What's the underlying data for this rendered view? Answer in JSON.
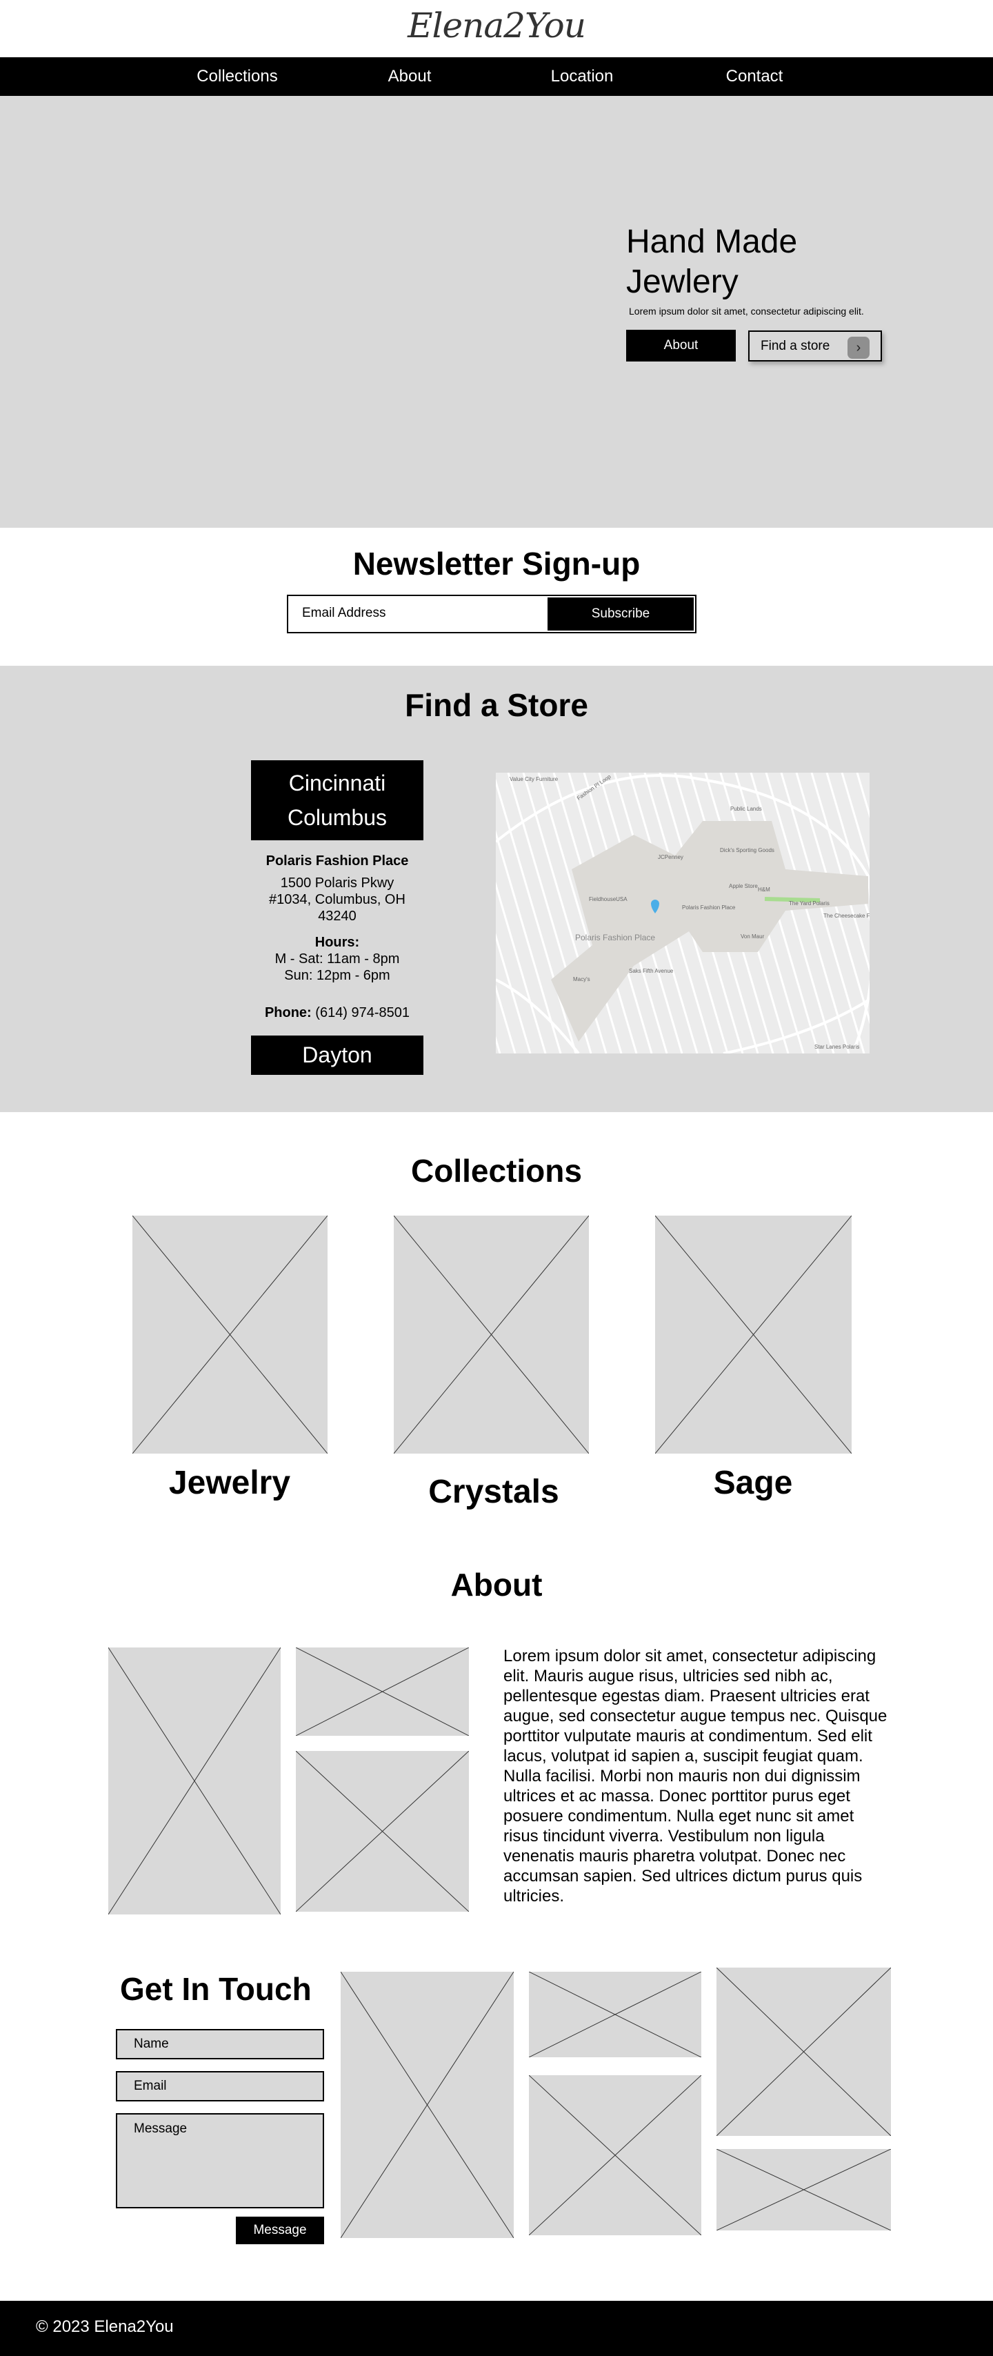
{
  "brand": {
    "logo": "Elena2You"
  },
  "nav": {
    "items": [
      "Collections",
      "About",
      "Location",
      "Contact"
    ]
  },
  "hero": {
    "title": "Hand Made Jewlery",
    "subtitle": "Lorem ipsum dolor sit amet, consectetur adipiscing elit.",
    "about_button": "About",
    "find_button": "Find a store",
    "find_icon": "chevron-right-icon"
  },
  "newsletter": {
    "title": "Newsletter Sign-up",
    "email_placeholder": "Email Address",
    "subscribe_button": "Subscribe"
  },
  "stores": {
    "title": "Find a Store",
    "cities": [
      "Cincinnati",
      "Columbus",
      "Dayton"
    ],
    "selected": "Columbus",
    "location_name": "Polaris Fashion Place",
    "address_line1": "1500 Polaris Pkwy",
    "address_line2": "#1034, Columbus, OH",
    "address_line3": "43240",
    "hours_label": "Hours:",
    "hours": [
      "M - Sat: 11am - 8pm",
      "Sun: 12pm - 6pm"
    ],
    "phone_label": "Phone:",
    "phone": "(614) 974-8501",
    "map": {
      "labels": [
        "Value City Furniture",
        "Fashion Pl Loop",
        "Public Lands",
        "Dick's Sporting Goods",
        "JCPenney",
        "FieldhouseUSA",
        "Apple Store",
        "H&M",
        "Polaris Fashion Place",
        "The Yard Polaris",
        "The Cheesecake Factory",
        "Von Maur",
        "Saks Fifth Avenue",
        "Macy's",
        "Star Lanes Polaris"
      ],
      "area_label": "Polaris Fashion Place",
      "pin_color": "#4aaee8"
    }
  },
  "collections": {
    "title": "Collections",
    "items": [
      "Jewelry",
      "Crystals",
      "Sage"
    ]
  },
  "about": {
    "title": "About",
    "text": "Lorem ipsum dolor sit amet, consectetur adipiscing elit. Mauris augue risus, ultricies sed nibh ac, pellentesque egestas diam. Praesent ultricies erat augue, sed consectetur augue tempus nec. Quisque porttitor vulputate mauris at condimentum. Sed elit lacus, volutpat id sapien a, suscipit feugiat quam. Nulla facilisi. Morbi non mauris non dui dignissim ultrices et ac massa. Donec porttitor purus eget posuere condimentum. Nulla eget nunc sit amet risus tincidunt viverra. Vestibulum non ligula venenatis mauris pharetra volutpat. Donec nec accumsan sapien. Sed ultrices dictum purus quis ultricies."
  },
  "contact": {
    "title": "Get In Touch",
    "name_placeholder": "Name",
    "email_placeholder": "Email",
    "message_placeholder": "Message",
    "submit_button": "Message"
  },
  "footer": {
    "copyright": "© 2023 Elena2You"
  },
  "colors": {
    "placeholder_gray": "#d9d9d9",
    "black": "#000000",
    "white": "#ffffff"
  }
}
